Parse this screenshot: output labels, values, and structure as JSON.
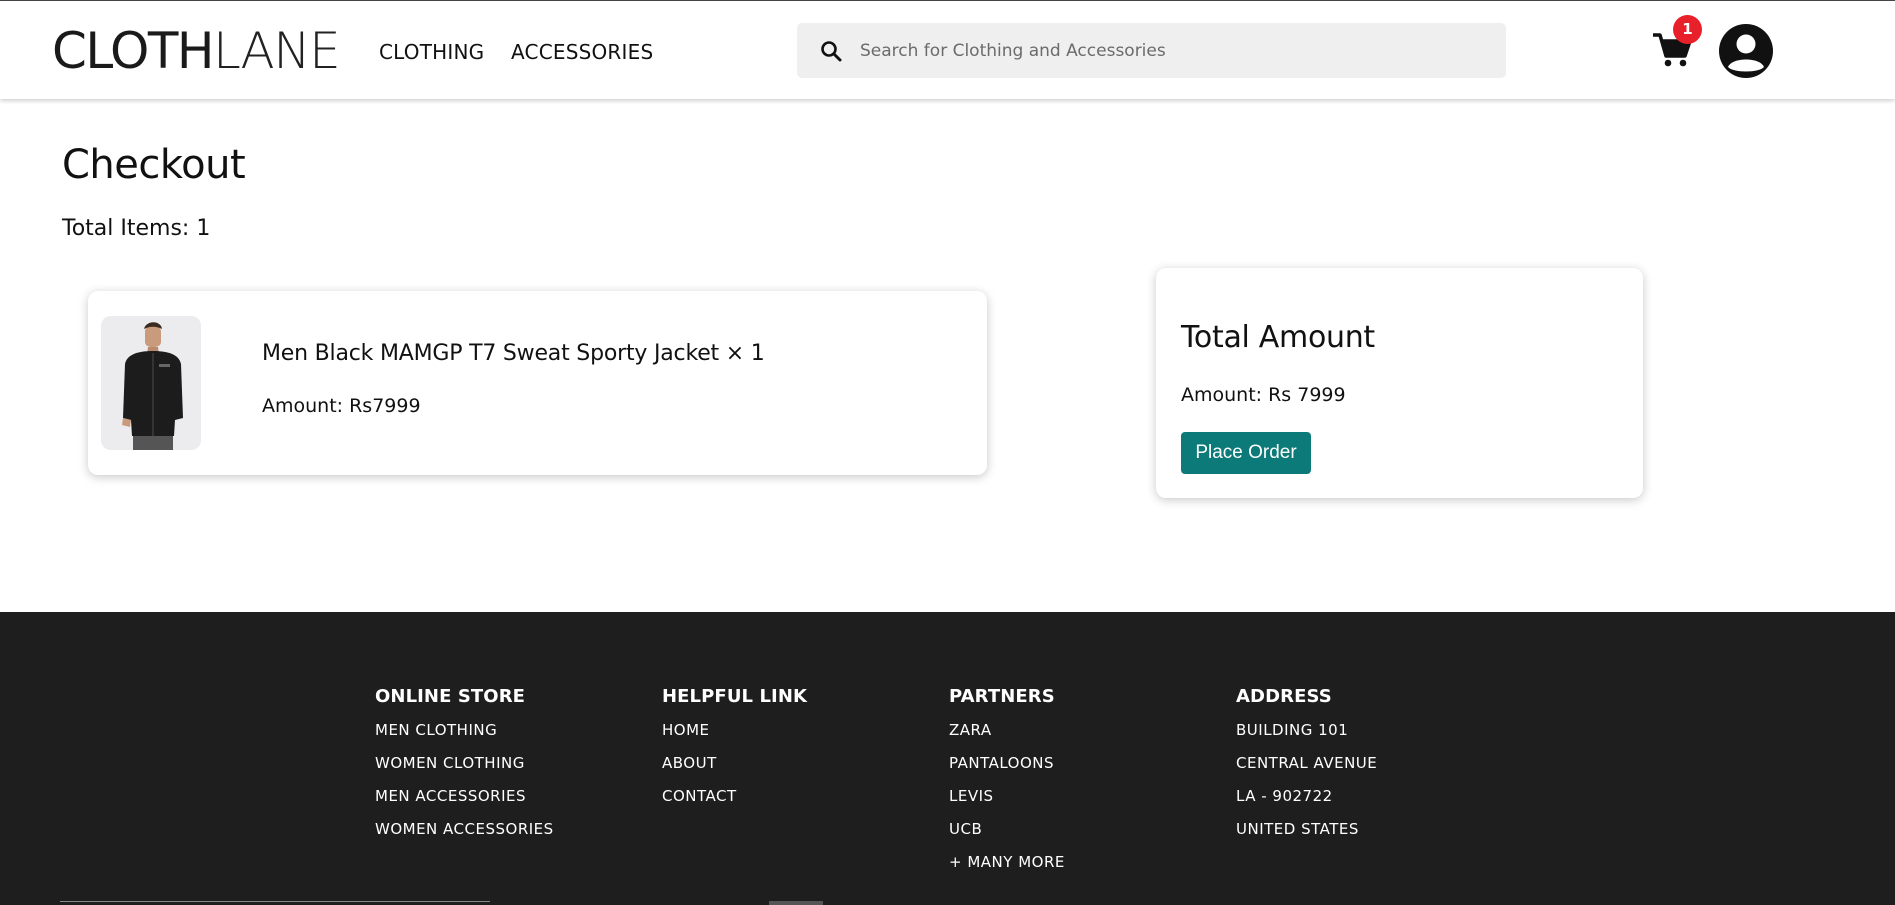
{
  "header": {
    "logo_bold": "CLOTH",
    "logo_light": "LANE",
    "nav": [
      "CLOTHING",
      "ACCESSORIES"
    ],
    "search_placeholder": "Search for Clothing and Accessories",
    "cart_count": "1",
    "icons": [
      "search-icon",
      "cart-icon",
      "user-avatar-icon"
    ]
  },
  "main": {
    "title": "Checkout",
    "total_items": "Total Items: 1",
    "item": {
      "name": "Men Black MAMGP T7 Sweat Sporty Jacket × 1",
      "amount": "Amount: Rs7999"
    },
    "summary": {
      "title": "Total Amount",
      "amount": "Amount: Rs 7999",
      "button": "Place Order"
    }
  },
  "footer": {
    "online_store": {
      "heading": "ONLINE STORE",
      "links": [
        "MEN CLOTHING",
        "WOMEN CLOTHING",
        "MEN ACCESSORIES",
        "WOMEN ACCESSORIES"
      ]
    },
    "helpful_link": {
      "heading": "HELPFUL LINK",
      "links": [
        "HOME",
        "ABOUT",
        "CONTACT"
      ]
    },
    "partners": {
      "heading": "PARTNERS",
      "links": [
        "ZARA",
        "PANTALOONS",
        "LEVIS",
        "UCB",
        "+ MANY MORE"
      ]
    },
    "address": {
      "heading": "ADDRESS",
      "lines": [
        "BUILDING 101",
        "CENTRAL AVENUE",
        "LA - 902722",
        "UNITED STATES"
      ]
    }
  },
  "colors": {
    "accent": "#0c7a78",
    "badge": "#e8202a",
    "footer_bg": "#1e1e1e",
    "search_bg": "#efefef"
  }
}
